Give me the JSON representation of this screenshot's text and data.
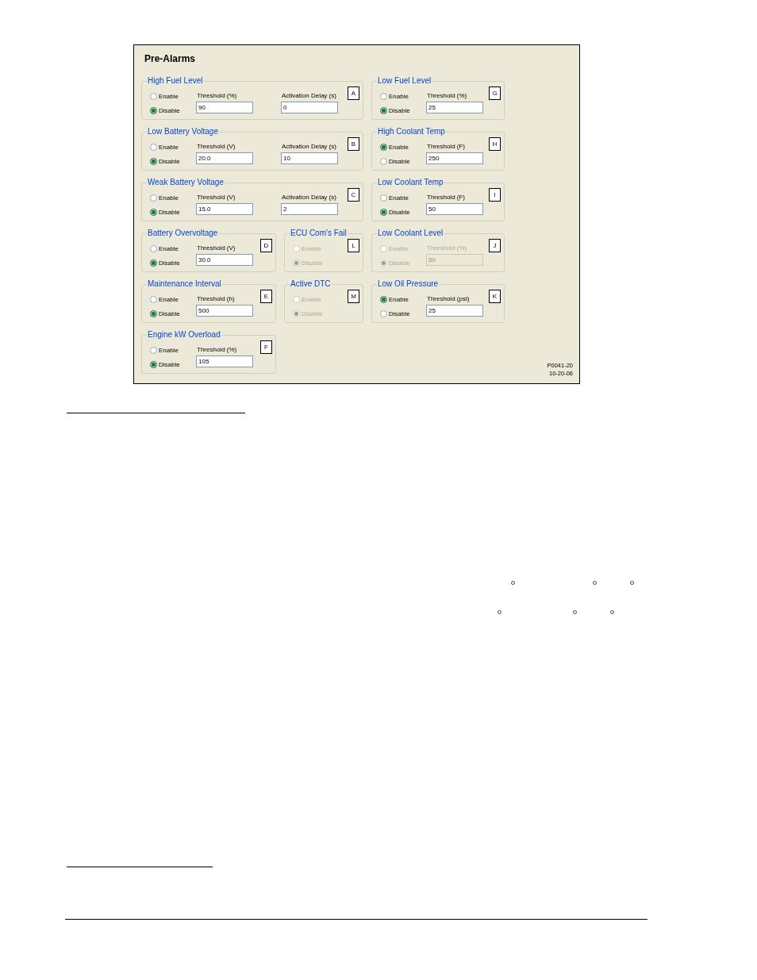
{
  "figure": {
    "title": "Pre-Alarms",
    "groups": [
      {
        "title": "High Fuel Level",
        "callout": "A",
        "disabled": false,
        "options": [
          {
            "label": "Enable",
            "selected": false
          },
          {
            "label": "Disable",
            "selected": true
          }
        ],
        "fields": [
          {
            "label": "Threshold (%)",
            "value": "90"
          },
          {
            "label": "Activation Delay (s)",
            "value": "0"
          }
        ]
      },
      {
        "title": "Low Fuel Level",
        "callout": "G",
        "disabled": false,
        "options": [
          {
            "label": "Enable",
            "selected": false
          },
          {
            "label": "Disable",
            "selected": true
          }
        ],
        "fields": [
          {
            "label": "Threshold (%)",
            "value": "25"
          }
        ]
      },
      {
        "title": "Low Battery Voltage",
        "callout": "B",
        "disabled": false,
        "options": [
          {
            "label": "Enable",
            "selected": false
          },
          {
            "label": "Disable",
            "selected": true
          }
        ],
        "fields": [
          {
            "label": "Threshold (V)",
            "value": "20.0"
          },
          {
            "label": "Activation Delay (s)",
            "value": "10"
          }
        ]
      },
      {
        "title": "High Coolant Temp",
        "callout": "H",
        "disabled": false,
        "options": [
          {
            "label": "Enable",
            "selected": true
          },
          {
            "label": "Disable",
            "selected": false
          }
        ],
        "fields": [
          {
            "label": "Threshold (F)",
            "value": "250"
          }
        ]
      },
      {
        "title": "Weak Battery Voltage",
        "callout": "C",
        "disabled": false,
        "options": [
          {
            "label": "Enable",
            "selected": false
          },
          {
            "label": "Disable",
            "selected": true
          }
        ],
        "fields": [
          {
            "label": "Threshold (V)",
            "value": "15.0"
          },
          {
            "label": "Activation Delay (s)",
            "value": "2"
          }
        ]
      },
      {
        "title": "Low Coolant Temp",
        "callout": "I",
        "disabled": false,
        "options": [
          {
            "label": "Enable",
            "selected": false
          },
          {
            "label": "Disable",
            "selected": true
          }
        ],
        "fields": [
          {
            "label": "Threshold (F)",
            "value": "50"
          }
        ]
      },
      {
        "title": "Battery Overvoltage",
        "callout": "D",
        "disabled": false,
        "options": [
          {
            "label": "Enable",
            "selected": false
          },
          {
            "label": "Disable",
            "selected": true
          }
        ],
        "fields": [
          {
            "label": "Threshold (V)",
            "value": "30.0"
          }
        ]
      },
      {
        "title": "ECU Com's Fail",
        "callout": "L",
        "disabled": true,
        "options": [
          {
            "label": "Enable",
            "selected": false
          },
          {
            "label": "Disable",
            "selected": true
          }
        ]
      },
      {
        "title": "Low Coolant Level",
        "callout": "J",
        "disabled": true,
        "options": [
          {
            "label": "Enable",
            "selected": false
          },
          {
            "label": "Disable",
            "selected": true
          }
        ],
        "fields": [
          {
            "label": "Threshold (%)",
            "value": "50"
          }
        ]
      },
      {
        "title": "Maintenance Interval",
        "callout": "E",
        "disabled": false,
        "options": [
          {
            "label": "Enable",
            "selected": false
          },
          {
            "label": "Disable",
            "selected": true
          }
        ],
        "fields": [
          {
            "label": "Threshold (h)",
            "value": "500"
          }
        ]
      },
      {
        "title": "Active DTC",
        "callout": "M",
        "disabled": true,
        "options": [
          {
            "label": "Enable",
            "selected": false
          },
          {
            "label": "Disable",
            "selected": true
          }
        ]
      },
      {
        "title": "Low Oil Pressure",
        "callout": "K",
        "disabled": false,
        "options": [
          {
            "label": "Enable",
            "selected": true
          },
          {
            "label": "Disable",
            "selected": false
          }
        ],
        "fields": [
          {
            "label": "Threshold (psi)",
            "value": "25"
          }
        ]
      },
      {
        "title": "Engine kW Overload",
        "callout": "F",
        "disabled": false,
        "options": [
          {
            "label": "Enable",
            "selected": false
          },
          {
            "label": "Disable",
            "selected": true
          }
        ],
        "fields": [
          {
            "label": "Threshold (%)",
            "value": "105"
          }
        ]
      }
    ],
    "caption": [
      "P0041-20",
      "10-20-06"
    ]
  }
}
